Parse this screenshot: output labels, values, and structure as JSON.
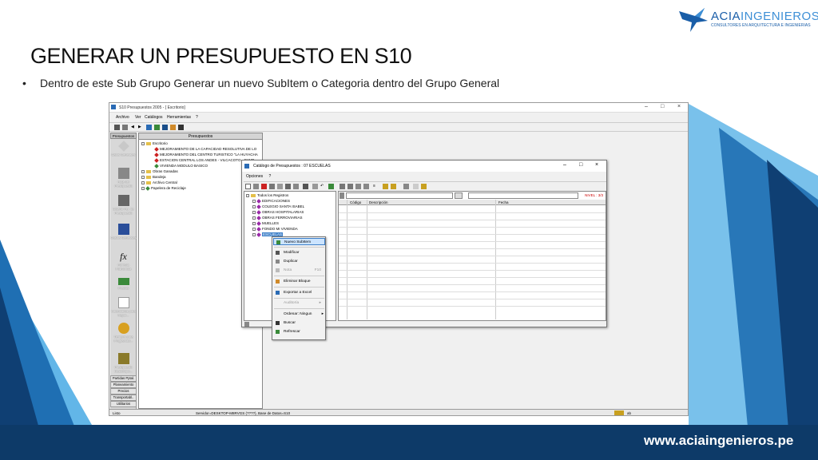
{
  "slide": {
    "title": "GENERAR UN PRESUPUESTO EN S10",
    "bullet": "Dentro de este Sub Grupo Generar un nuevo SubItem o Categoria dentro del Grupo General",
    "footer_url": "www.aciaingenieros.pe",
    "logo_name_bold": "ACIA",
    "logo_name_light": "INGENIEROS",
    "logo_sub": "CONSULTORES EN ARQUITECTURA E INGENIERIAS",
    "colors": {
      "dark_blue": "#0f3f73",
      "mid_blue": "#1f6fb3",
      "light_blue": "#62b6e8",
      "bar": "#0d3a68"
    }
  },
  "app": {
    "title": "S10 Presupuestos 2005 - [ Escritorio]",
    "menu": [
      "Archivo",
      "Ver",
      "Catálogos",
      "Herramientas",
      "?"
    ],
    "sidebar": {
      "tab": "Presupuestos",
      "items": [
        "Datos Generales",
        "Hoja del Presupuesto",
        "Diseño Per. de Presupuesto",
        "Gastos Generales",
        "Fórmula Polinómica",
        "Precios",
        "Calendarios para Repor...",
        "Tiempos para Programaci...",
        "Presupuesto Descompo..."
      ],
      "buttons": [
        "Partidas Pptal.",
        "Planeamiento",
        "Precios",
        "Transportabl..",
        "Utilitarios"
      ]
    },
    "tree_header": "Presupuestos",
    "tree": {
      "root": "Escritorio",
      "children": [
        "MEJORAMIENTO DE LA CAPACIDAD RESOLUTIVA DE LO",
        "MEJORAMIENTO DEL CENTRO TURISTICO \"LA HUYACHA",
        "ESTACION CENTRAL LOS ANDES - VILCACOTO - CHUP",
        "VIVIENDA  MODULO BASICO"
      ],
      "others": [
        "Obras Ganadas",
        "Bandeja",
        "Archivo Central",
        "Papelera de Reciclaje"
      ]
    },
    "status": {
      "left": "Listo",
      "middle": "Servidor=DESKTOP-M8RVGS (????), Base de Datos=S10",
      "right": "ab"
    }
  },
  "dialog": {
    "title": "Catálogo de Presupuestos : 07 ESCUELAS",
    "menu": [
      "Opciones",
      "?"
    ],
    "tree_root": "Todos los Registros",
    "tree_items": [
      "EDIFICACIONES",
      "COLEGIO SANTA ISABEL",
      "OBRAS HOSPITALARIAS",
      "OBRAS FERROVIARIAS",
      "MUELLES",
      "FONDO MI VIVIENDA",
      "ESCUELAS"
    ],
    "nivel": "NIVEL : 3/3",
    "columns": [
      "Código",
      "Descripción",
      "Fecha"
    ]
  },
  "context_menu": {
    "items": [
      {
        "label": "Nuevo SubItem",
        "state": "selected"
      },
      {
        "label": "Modificar",
        "state": "normal"
      },
      {
        "label": "Duplicar",
        "state": "normal"
      },
      {
        "label": "Nota",
        "shortcut": "F10",
        "state": "disabled"
      },
      {
        "label": "Eliminar Bloque",
        "state": "normal"
      },
      {
        "label": "Exportar a Excel",
        "state": "normal"
      },
      {
        "label": "Auditoría",
        "state": "disabled"
      },
      {
        "label": "Ordenar: Ningun",
        "state": "normal"
      },
      {
        "label": "Buscar",
        "state": "normal"
      },
      {
        "label": "Refrescar",
        "state": "normal"
      }
    ]
  }
}
